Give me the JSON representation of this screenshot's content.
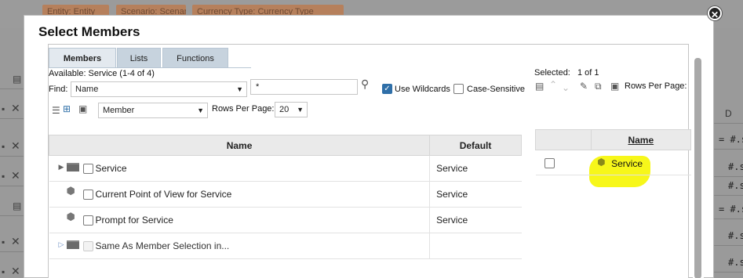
{
  "background": {
    "chips": [
      "Entity: Entity",
      "Scenario: Scenario",
      "Currency Type: Currency Type"
    ],
    "column_header": "D",
    "right_cells": [
      "= #.s",
      "#.s",
      "#.s",
      "= #.s",
      "#.s",
      "#.s"
    ]
  },
  "dialog": {
    "title": "Select Members",
    "tabs": [
      "Members",
      "Lists",
      "Functions"
    ],
    "available": "Available:  Service (1-4 of 4)",
    "find_label": "Find:",
    "find_field": "Name",
    "find_value": "*",
    "use_wildcards": "Use Wildcards",
    "case_sensitive": "Case-Sensitive",
    "view_select": "Member",
    "rows_per_page_label": "Rows Per Page:",
    "rows_per_page": "20",
    "columns": [
      "Name",
      "Default"
    ],
    "rows": [
      {
        "name": "Service",
        "default": "Service",
        "icon": "folder-icon",
        "expand": true
      },
      {
        "name": "Current Point of View for Service",
        "default": "Service",
        "icon": "cube-icon",
        "expand": false
      },
      {
        "name": "Prompt for Service",
        "default": "Service",
        "icon": "cube-icon",
        "expand": false
      },
      {
        "name": "Same As Member Selection in...",
        "default": "",
        "icon": "folder-icon",
        "expand": true
      }
    ],
    "selected_label": "Selected:",
    "selected_count": "1 of 1",
    "selected_rows_per_page": "Rows Per Page:",
    "selected_column": "Name",
    "selected_rows": [
      {
        "name": "Service"
      }
    ],
    "highlight_color": "#f7f71a",
    "tab_color": "#c7d3de"
  }
}
